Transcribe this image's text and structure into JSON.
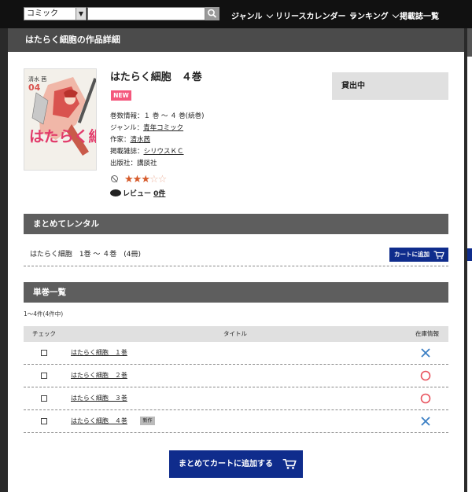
{
  "header": {
    "category_select": "コミック",
    "search_placeholder": "",
    "nav": [
      "ジャンル",
      "リリースカレンダー",
      "ランキング",
      "掲載誌一覧"
    ]
  },
  "page": {
    "title": "はたらく細胞の作品詳細"
  },
  "work": {
    "title": "はたらく細胞　４巻",
    "badge": "NEW",
    "volume_info": "巻数情報：１ 巻 ～ ４ 巻(続巻)",
    "genre_label": "ジャンル：",
    "genre": "青年コミック",
    "author_label": "作家：",
    "author": "清水茜",
    "magazine_label": "掲載雑誌：",
    "magazine": "シリウスＫＣ",
    "publisher": "出版社：講談社",
    "rating": 3,
    "rating_max": 5,
    "review_label": "レビュー",
    "review_count": "0件",
    "rental_status": "貸出中",
    "cover": {
      "author_text": "清水 茜",
      "volume_text": "04",
      "title_text": "はたらく細胞"
    }
  },
  "bulk": {
    "heading": "まとめてレンタル",
    "item": "はたらく細胞　1巻 ～ ４巻　(4冊)",
    "cart_button": "カートに追加"
  },
  "volumes": {
    "heading": "単巻一覧",
    "count": "1～4件(4件中)",
    "columns": [
      "チェック",
      "タイトル",
      "在庫情報"
    ],
    "rows": [
      {
        "title": "はたらく細胞　１巻",
        "badge": "",
        "stock": "unavailable"
      },
      {
        "title": "はたらく細胞　２巻",
        "badge": "",
        "stock": "available"
      },
      {
        "title": "はたらく細胞　３巻",
        "badge": "",
        "stock": "available"
      },
      {
        "title": "はたらく細胞　４巻",
        "badge": "新作",
        "stock": "unavailable"
      }
    ],
    "bulk_add_button": "まとめてカートに追加する"
  },
  "colors": {
    "accent_blue": "#0f2c8c",
    "new_pink": "#f4577c",
    "stock_ok": "#e8535e",
    "stock_ng": "#3b7fc4",
    "star": "#d65a2a"
  }
}
